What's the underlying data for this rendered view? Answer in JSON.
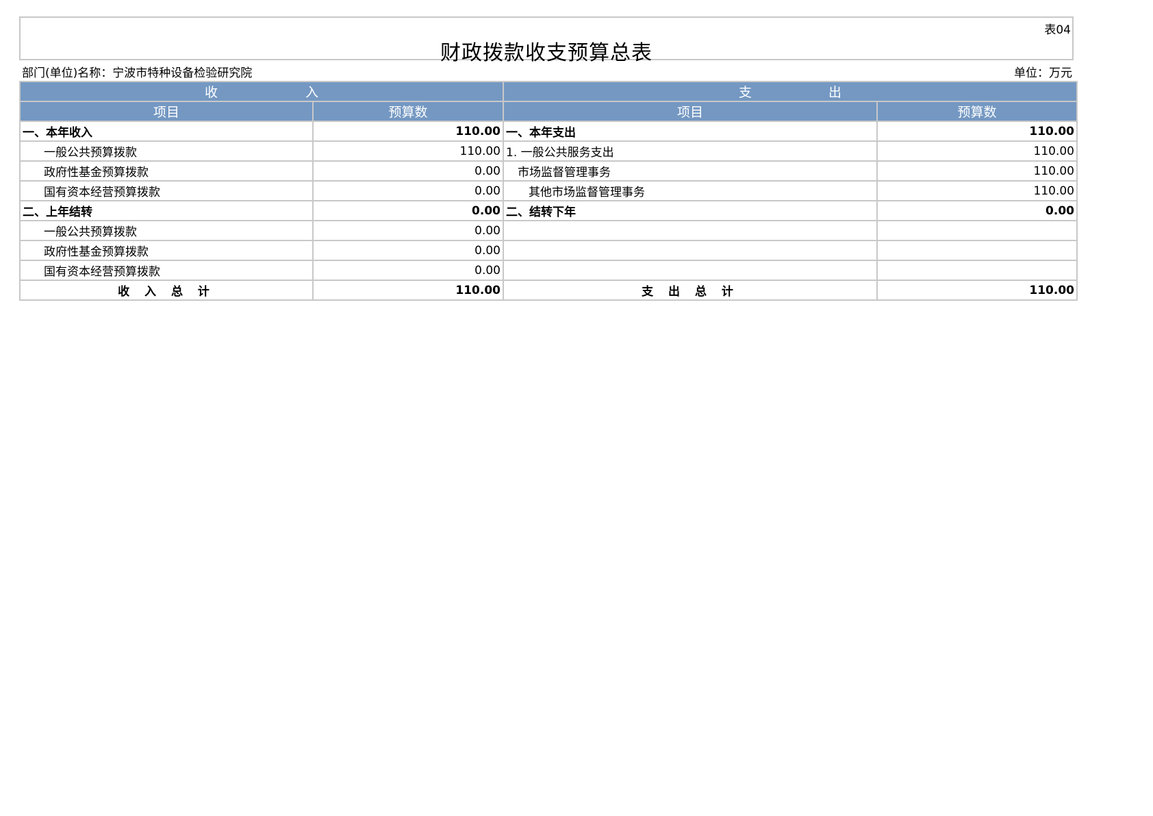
{
  "table_no": "表04",
  "title": "财政拨款收支预算总表",
  "dept_label": "部门(单位)名称：宁波市特种设备检验研究院",
  "unit_label": "单位：万元",
  "header": {
    "income_a": "收",
    "income_b": "入",
    "expense_a": "支",
    "expense_b": "出",
    "item": "项目",
    "budget": "预算数"
  },
  "rows": [
    {
      "in_item": "一、本年收入",
      "in_val": "110.00",
      "ex_item": "一、本年支出",
      "ex_val": "110.00"
    },
    {
      "in_item": "一般公共预算拨款",
      "in_val": "110.00",
      "ex_item": "1. 一般公共服务支出",
      "ex_val": "110.00"
    },
    {
      "in_item": "政府性基金预算拨款",
      "in_val": "0.00",
      "ex_item": "市场监督管理事务",
      "ex_val": "110.00"
    },
    {
      "in_item": "国有资本经营预算拨款",
      "in_val": "0.00",
      "ex_item": "其他市场监督管理事务",
      "ex_val": "110.00"
    },
    {
      "in_item": "二、上年结转",
      "in_val": "0.00",
      "ex_item": "二、结转下年",
      "ex_val": "0.00"
    },
    {
      "in_item": "一般公共预算拨款",
      "in_val": "0.00",
      "ex_item": "",
      "ex_val": ""
    },
    {
      "in_item": "政府性基金预算拨款",
      "in_val": "0.00",
      "ex_item": "",
      "ex_val": ""
    },
    {
      "in_item": "国有资本经营预算拨款",
      "in_val": "0.00",
      "ex_item": "",
      "ex_val": ""
    }
  ],
  "totals": {
    "in_label": "收 入 总 计",
    "in_val": "110.00",
    "ex_label": "支 出 总 计",
    "ex_val": "110.00"
  }
}
